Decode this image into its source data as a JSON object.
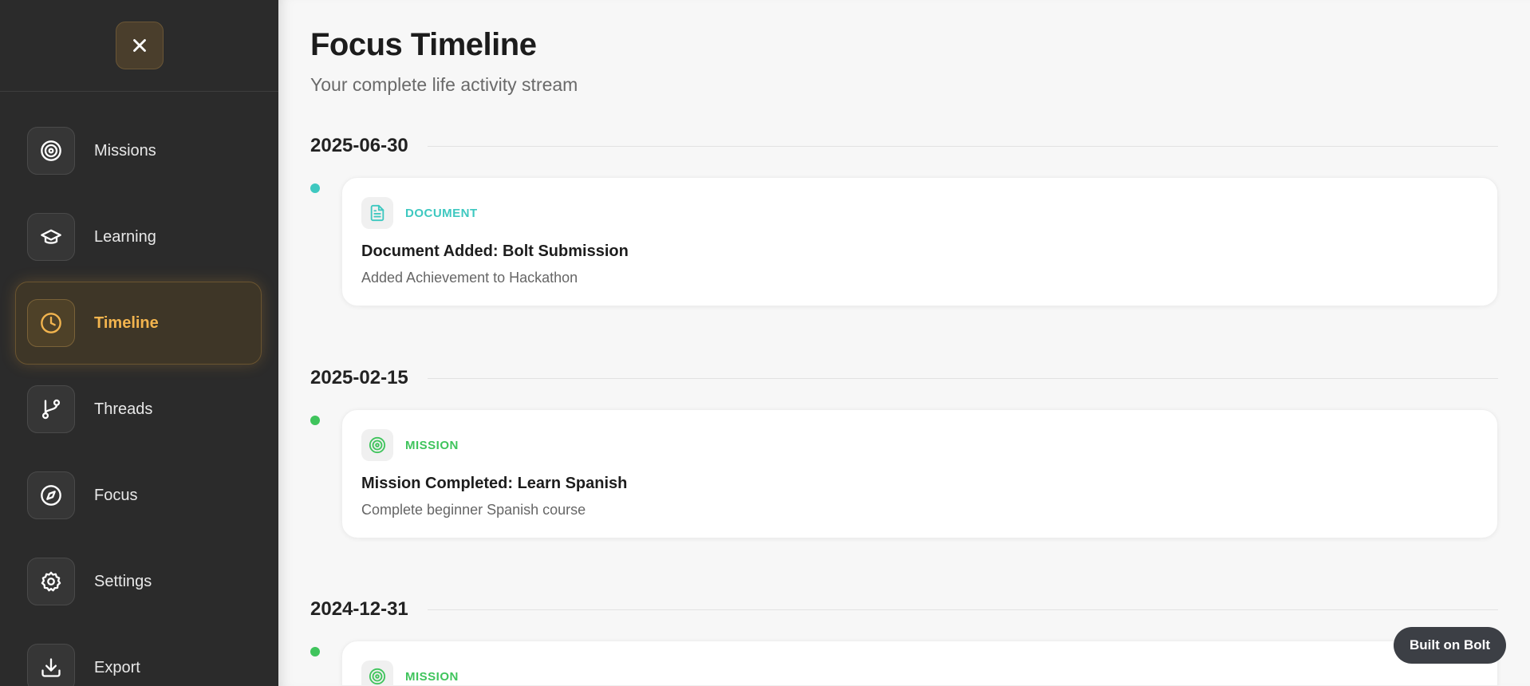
{
  "sidebar": {
    "close_icon": "close-icon",
    "items": [
      {
        "label": "Missions",
        "icon": "target-icon"
      },
      {
        "label": "Learning",
        "icon": "graduation-cap-icon"
      },
      {
        "label": "Timeline",
        "icon": "clock-icon",
        "active": true
      },
      {
        "label": "Threads",
        "icon": "git-branch-icon"
      },
      {
        "label": "Focus",
        "icon": "compass-icon"
      },
      {
        "label": "Settings",
        "icon": "gear-icon"
      },
      {
        "label": "Export",
        "icon": "download-icon"
      }
    ]
  },
  "main": {
    "title": "Focus Timeline",
    "subtitle": "Your complete life activity stream",
    "groups": [
      {
        "date": "2025-06-30",
        "dot_color": "#3ec8c0",
        "entry": {
          "type_label": "DOCUMENT",
          "type_color": "#3ec8c0",
          "icon": "document-icon",
          "title": "Document Added: Bolt Submission",
          "description": "Added Achievement to Hackathon"
        }
      },
      {
        "date": "2025-02-15",
        "dot_color": "#3fc45c",
        "entry": {
          "type_label": "MISSION",
          "type_color": "#3fc45c",
          "icon": "target-icon",
          "title": "Mission Completed: Learn Spanish",
          "description": "Complete beginner Spanish course"
        }
      },
      {
        "date": "2024-12-31",
        "dot_color": "#3fc45c",
        "entry": {
          "type_label": "MISSION",
          "type_color": "#3fc45c",
          "icon": "target-icon"
        }
      }
    ]
  },
  "badge": {
    "label": "Built on Bolt"
  },
  "colors": {
    "accent": "#f2b44e",
    "sidebar_bg": "#2b2b2b",
    "document": "#3ec8c0",
    "mission": "#3fc45c"
  }
}
